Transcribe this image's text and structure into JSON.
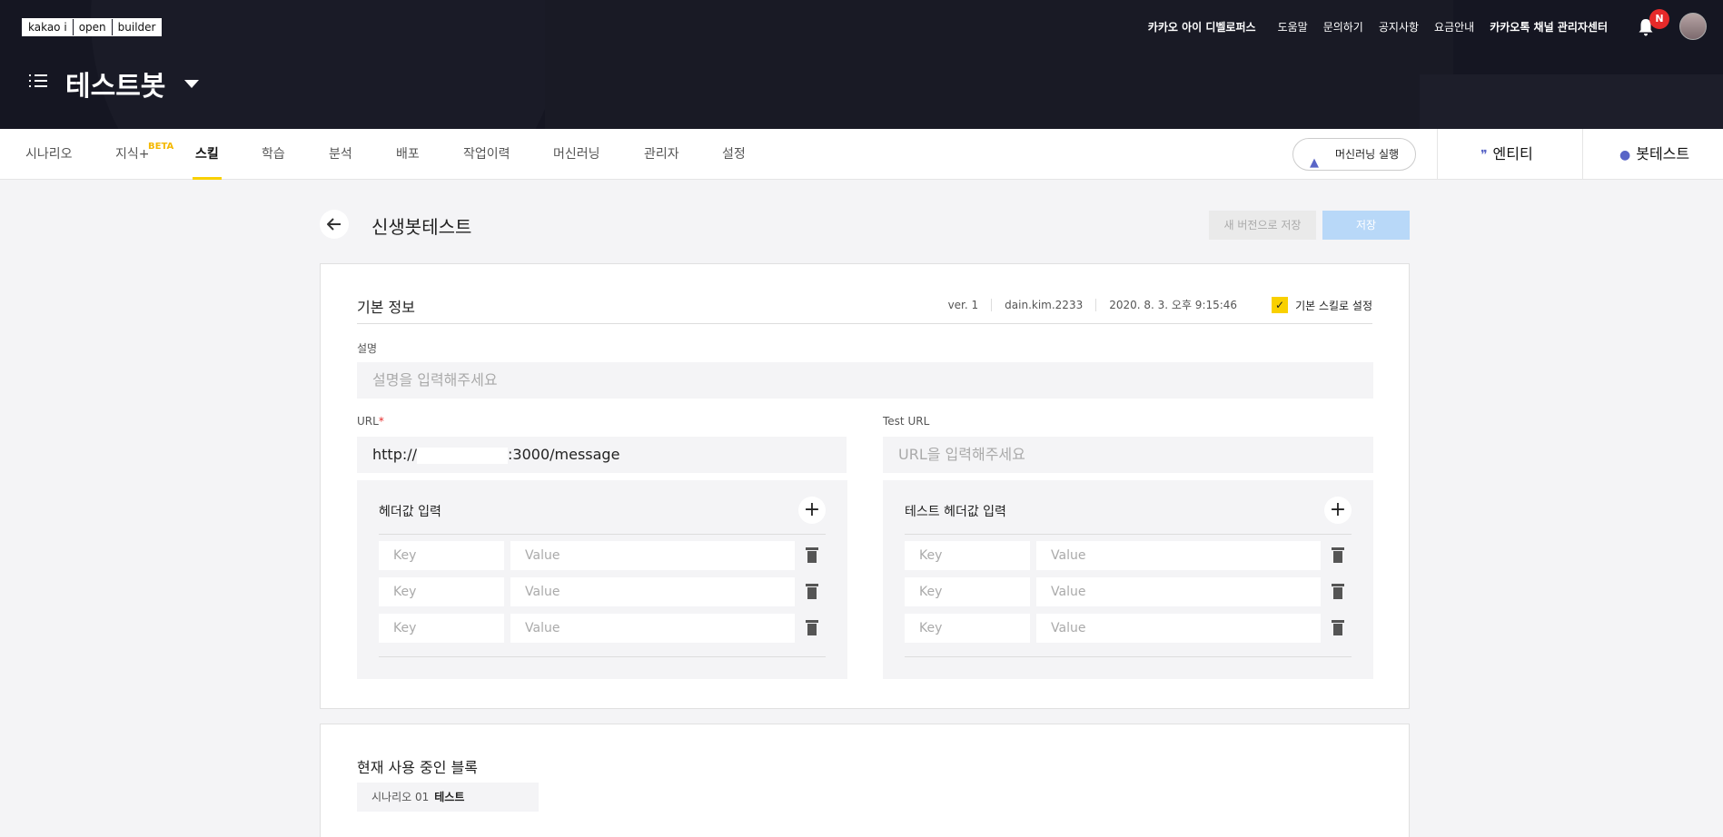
{
  "logo": [
    "kakao i",
    "open",
    "builder"
  ],
  "global_nav": [
    "카카오 아이 디벨로퍼스",
    "도움말",
    "문의하기",
    "공지사항",
    "요금안내",
    "카카오톡 채널 관리자센터"
  ],
  "notification_badge": "N",
  "bot_name": "테스트봇",
  "tabs": [
    "시나리오",
    "지식+",
    "스킬",
    "학습",
    "분석",
    "배포",
    "작업이력",
    "머신러닝",
    "관리자",
    "설정"
  ],
  "beta_label": "BETA",
  "active_tab": "스킬",
  "ml_run_label": "머신러닝 실행",
  "entity_label": "엔티티",
  "bottest_label": "봇테스트",
  "page": {
    "title": "신생봇테스트",
    "save_new_version": "새 버전으로 저장",
    "save": "저장"
  },
  "basic": {
    "title": "기본 정보",
    "version": "ver. 1",
    "author": "dain.kim.2233",
    "date": "2020. 8. 3. 오후 9:15:46",
    "default_skill_label": "기본 스킬로 설정",
    "desc_label": "설명",
    "desc_placeholder": "설명을 입력해주세요",
    "url_label": "URL",
    "url_required": "*",
    "url_prefix": "http://",
    "url_suffix": ":3000/message",
    "test_url_label": "Test URL",
    "test_url_placeholder": "URL을 입력해주세요"
  },
  "header_box": {
    "title": "헤더값 입력",
    "key_placeholder": "Key",
    "value_placeholder": "Value"
  },
  "test_header_box": {
    "title": "테스트 헤더값 입력",
    "key_placeholder": "Key",
    "value_placeholder": "Value"
  },
  "blocks": {
    "title": "현재 사용 중인 블록",
    "scenario": "시나리오 01",
    "block": "테스트"
  },
  "colors": {
    "accent": "#f9d000",
    "header_bg": "#151622",
    "save_btn": "#b8d8f8"
  }
}
